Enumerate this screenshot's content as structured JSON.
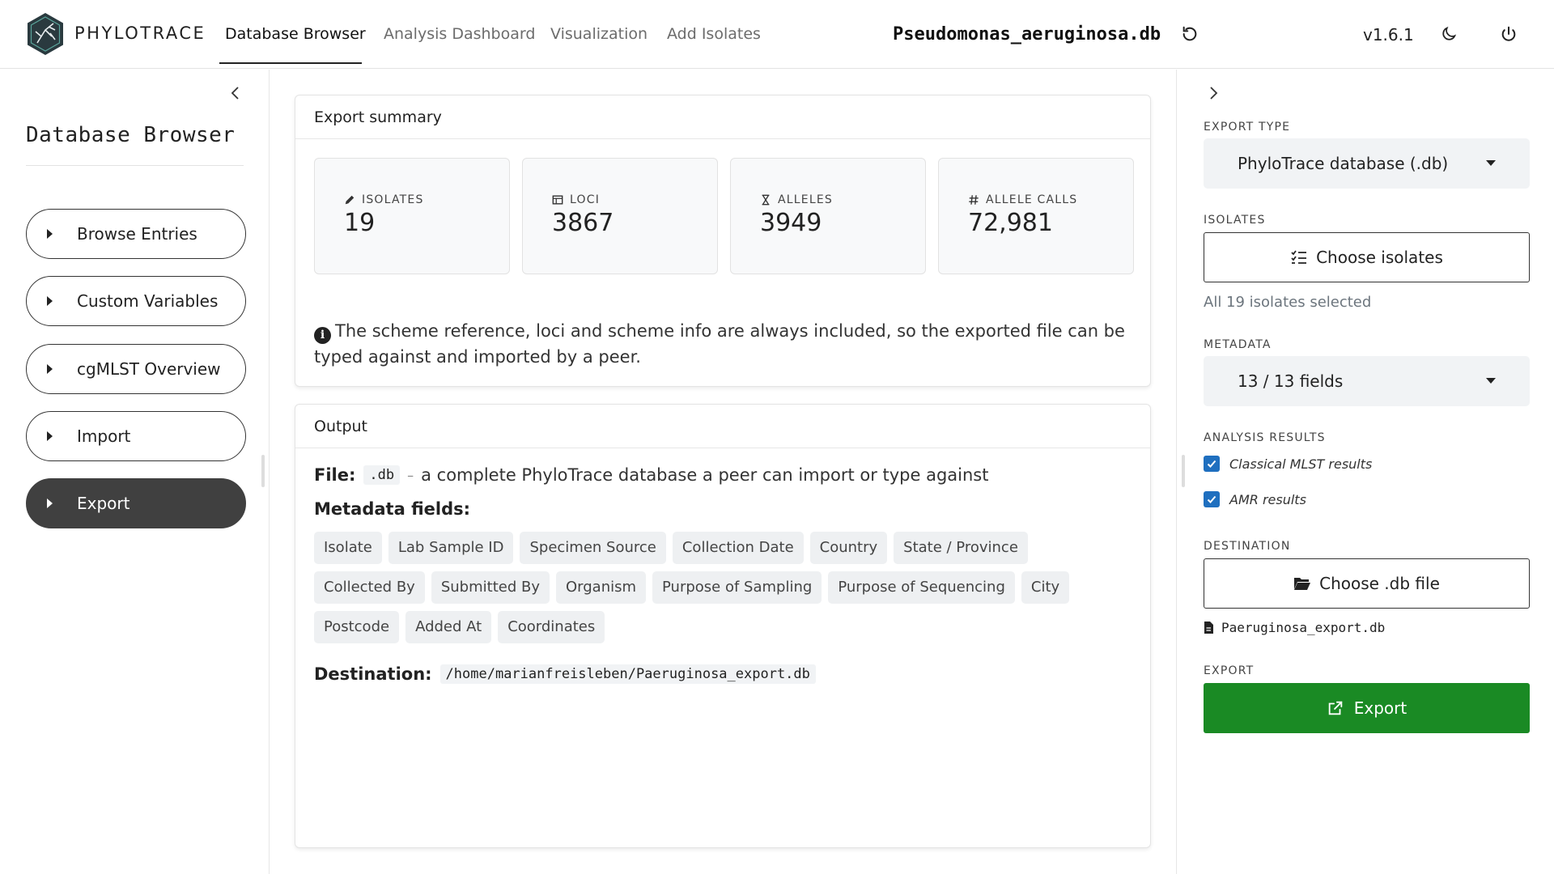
{
  "app": {
    "brand": "PHYLOTRACE",
    "version": "v1.6.1",
    "database_name": "Pseudomonas_aeruginosa.db",
    "brand_color": "#2a3a3f",
    "accent_export": "#1a8a24"
  },
  "nav": {
    "tabs": [
      {
        "label": "Database Browser",
        "active": true
      },
      {
        "label": "Analysis Dashboard",
        "active": false
      },
      {
        "label": "Visualization",
        "active": false
      },
      {
        "label": "Add Isolates",
        "active": false
      }
    ],
    "icons": [
      "refresh-icon",
      "moon-icon",
      "power-icon"
    ]
  },
  "sidebar": {
    "title": "Database Browser",
    "items": [
      {
        "label": "Browse Entries",
        "active": false
      },
      {
        "label": "Custom Variables",
        "active": false
      },
      {
        "label": "cgMLST Overview",
        "active": false
      },
      {
        "label": "Import",
        "active": false
      },
      {
        "label": "Export",
        "active": true
      }
    ]
  },
  "summary": {
    "header": "Export summary",
    "stats": [
      {
        "icon": "pencil-icon",
        "label": "ISOLATES",
        "value": "19"
      },
      {
        "icon": "table-icon",
        "label": "LOCI",
        "value": "3867"
      },
      {
        "icon": "hourglass-icon",
        "label": "ALLELES",
        "value": "3949"
      },
      {
        "icon": "hash-icon",
        "label": "ALLELE CALLS",
        "value": "72,981"
      }
    ],
    "note": "The scheme reference, loci and scheme info are always included, so the exported file can be typed against and imported by a peer."
  },
  "output": {
    "header": "Output",
    "file_label": "File:",
    "file_ext": ".db",
    "file_sep": "–",
    "file_desc": "a complete PhyloTrace database a peer can import or type against",
    "metadata_label": "Metadata fields:",
    "metadata_fields": [
      "Isolate",
      "Lab Sample ID",
      "Specimen Source",
      "Collection Date",
      "Country",
      "State / Province",
      "Collected By",
      "Submitted By",
      "Organism",
      "Purpose of Sampling",
      "Purpose of Sequencing",
      "City",
      "Postcode",
      "Added At",
      "Coordinates"
    ],
    "destination_label": "Destination:",
    "destination_path": "/home/marianfreisleben/Paeruginosa_export.db"
  },
  "right": {
    "export_type_label": "EXPORT TYPE",
    "export_type_value": "PhyloTrace database (.db)",
    "isolates_label": "ISOLATES",
    "choose_isolates": "Choose isolates",
    "isolates_status": "All 19 isolates selected",
    "metadata_label": "METADATA",
    "metadata_value": "13 / 13 fields",
    "analysis_label": "ANALYSIS RESULTS",
    "analysis_options": [
      {
        "label": "Classical MLST results",
        "checked": true
      },
      {
        "label": "AMR results",
        "checked": true
      }
    ],
    "destination_label": "DESTINATION",
    "choose_file": "Choose .db file",
    "selected_file": "Paeruginosa_export.db",
    "export_label": "EXPORT",
    "export_button": "Export"
  }
}
